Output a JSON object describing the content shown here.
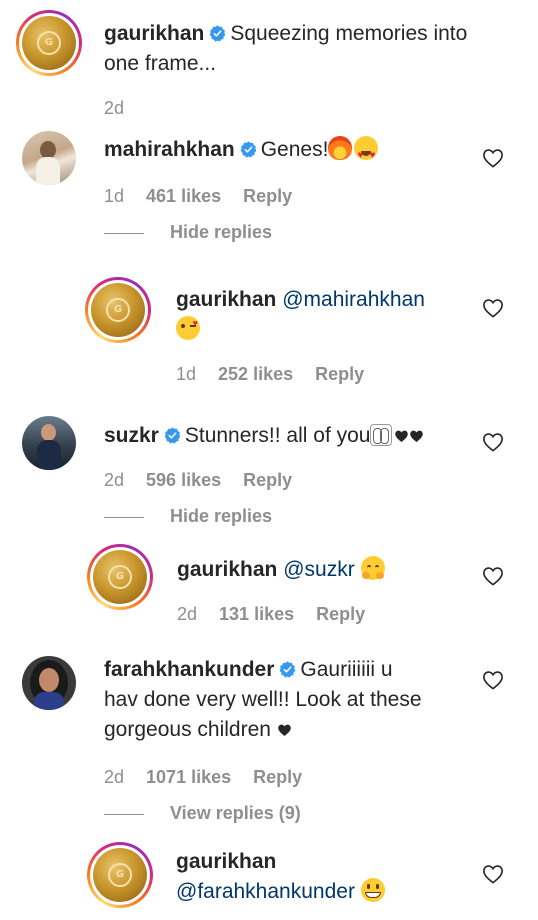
{
  "caption": {
    "username": "gaurikhan",
    "text_line1": "Squeezing memories into",
    "text_line2": "one frame...",
    "time": "2d"
  },
  "comments": [
    {
      "username": "mahirahkhan",
      "text": "Genes!",
      "emojis": [
        "fire",
        "heart-eyes"
      ],
      "time": "1d",
      "likes": "461 likes",
      "reply": "Reply",
      "toggle": "Hide replies",
      "replies": [
        {
          "username": "gaurikhan",
          "mention": "@mahirahkhan",
          "emojis": [
            "kiss-wink"
          ],
          "time": "1d",
          "likes": "252 likes",
          "reply": "Reply"
        }
      ]
    },
    {
      "username": "suzkr",
      "text": "Stunners!! all of you",
      "emojis": [
        "raised-hands",
        "black-heart",
        "black-heart"
      ],
      "time": "2d",
      "likes": "596 likes",
      "reply": "Reply",
      "toggle": "Hide replies",
      "replies": [
        {
          "username": "gaurikhan",
          "mention": "@suzkr",
          "emojis": [
            "hugging"
          ],
          "time": "2d",
          "likes": "131 likes",
          "reply": "Reply"
        }
      ]
    },
    {
      "username": "farahkhankunder",
      "text_line1": "Gauriiiiii u",
      "text_line2": "hav done very well!! Look at these",
      "text_line3": "gorgeous children",
      "emojis": [
        "black-heart"
      ],
      "time": "2d",
      "likes": "1071 likes",
      "reply": "Reply",
      "toggle": "View replies (9)",
      "replies": [
        {
          "username": "gaurikhan",
          "mention": "@farahkhankunder",
          "emojis": [
            "grinning"
          ]
        }
      ]
    }
  ],
  "colors": {
    "verified": "#3897f0",
    "mention": "#00376b",
    "meta": "#8e8e8e",
    "text": "#262626"
  },
  "icons": [
    "verified-badge-icon",
    "heart-outline-icon"
  ]
}
